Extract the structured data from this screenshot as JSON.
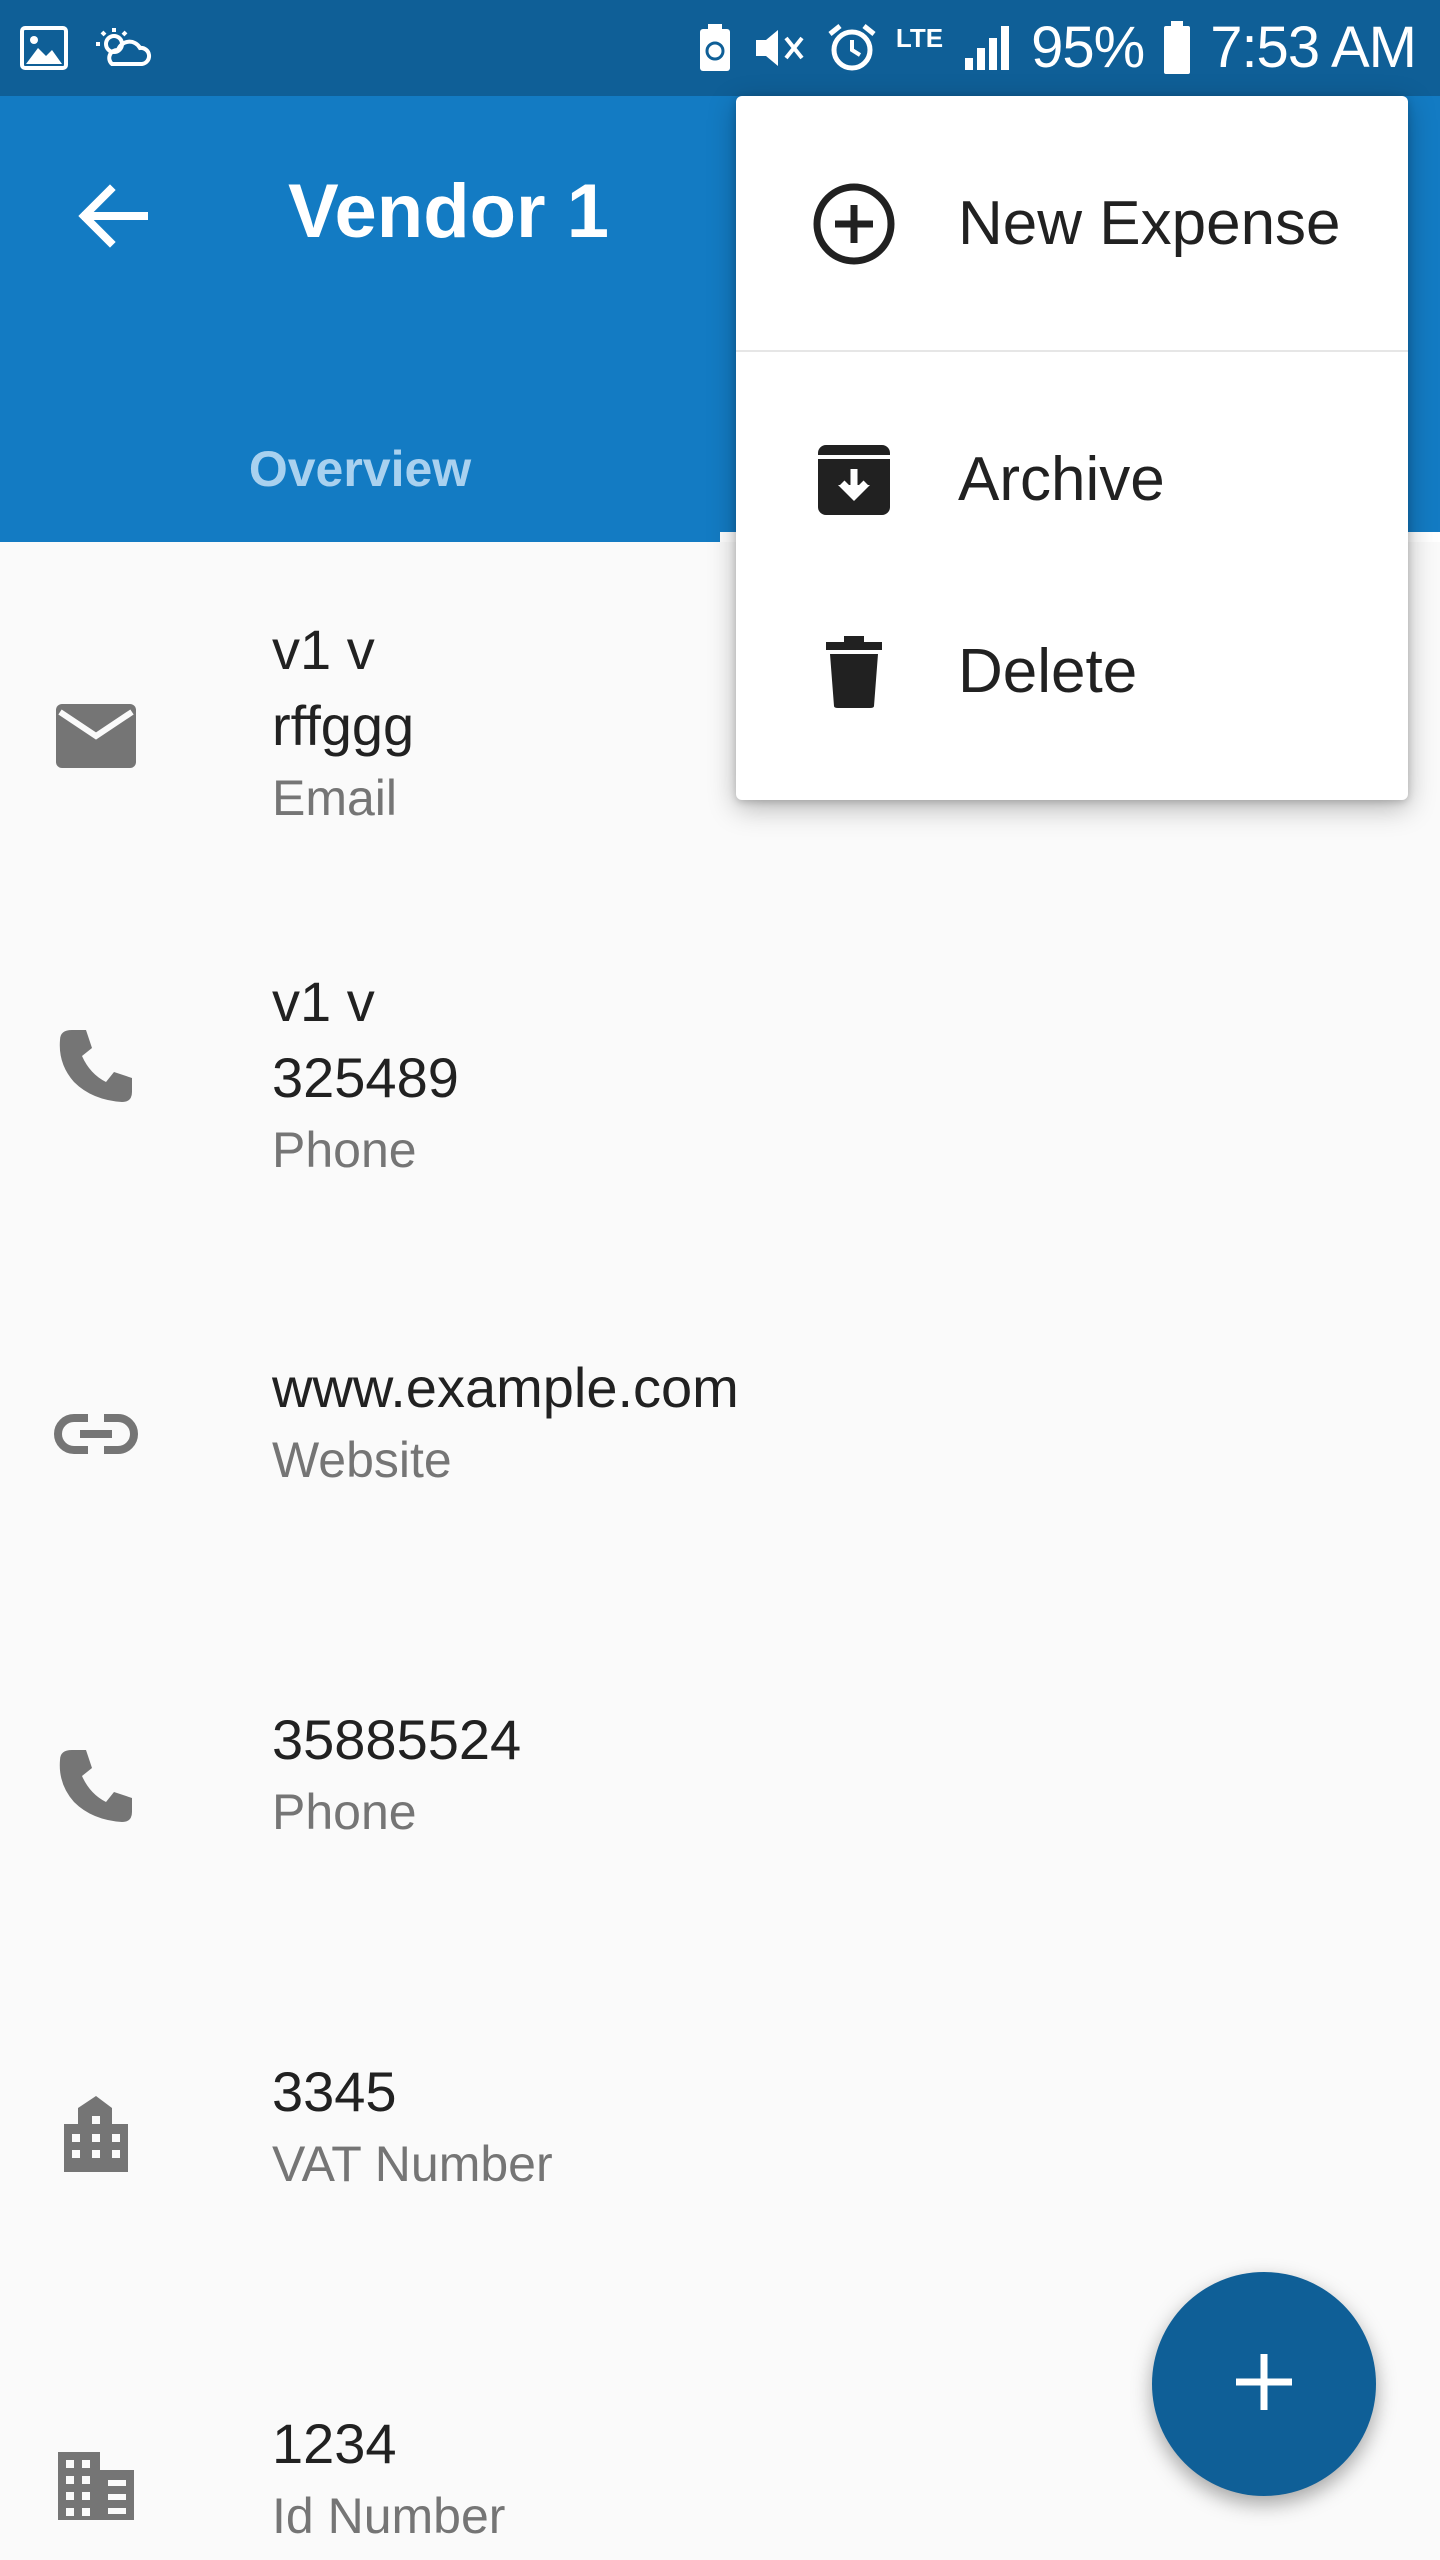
{
  "status_bar": {
    "battery_percent": "95%",
    "time": "7:53 AM",
    "network": "LTE",
    "icons_left": [
      "image-icon",
      "weather-icon"
    ],
    "icons_right": [
      "battery-saver-icon",
      "mute-vibrate-icon",
      "alarm-icon",
      "lte-icon",
      "signal-icon",
      "battery-icon"
    ]
  },
  "app_bar": {
    "title": "Vendor 1",
    "back_icon": "arrow-left-icon",
    "tabs": [
      {
        "label": "Overview",
        "selected": false
      }
    ]
  },
  "details": [
    {
      "icon": "email-icon",
      "lines": [
        "v1 v",
        "rffggg"
      ],
      "type": "Email"
    },
    {
      "icon": "phone-icon",
      "lines": [
        "v1 v",
        "325489"
      ],
      "type": "Phone"
    },
    {
      "icon": "link-icon",
      "lines": [
        "www.example.com"
      ],
      "type": "Website"
    },
    {
      "icon": "phone-icon",
      "lines": [
        "35885524"
      ],
      "type": "Phone"
    },
    {
      "icon": "business-icon",
      "lines": [
        "3345"
      ],
      "type": "VAT Number"
    },
    {
      "icon": "domain-icon",
      "lines": [
        "1234"
      ],
      "type": "Id Number"
    }
  ],
  "menu": {
    "items": [
      {
        "label": "New Expense",
        "icon": "add-circle-icon"
      },
      {
        "label": "Archive",
        "icon": "archive-icon"
      },
      {
        "label": "Delete",
        "icon": "delete-icon"
      }
    ]
  },
  "fab": {
    "icon": "plus-icon"
  },
  "colors": {
    "status_bar": "#0f5f97",
    "app_bar": "#137bc3",
    "tab_inactive": "#a9d1ef",
    "fab": "#0f5f97",
    "icon_gray": "#757575"
  }
}
